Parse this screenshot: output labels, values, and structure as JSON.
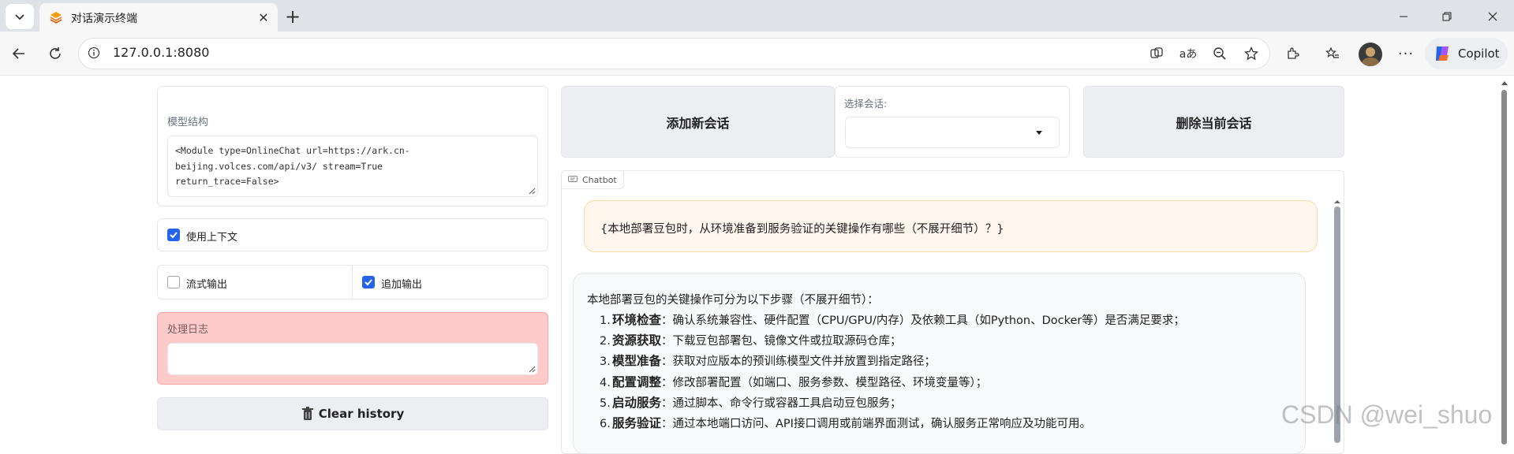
{
  "browser": {
    "tab_title": "对话演示终端",
    "url": "127.0.0.1:8080",
    "copilot_label": "Copilot",
    "translate_label": "aあ"
  },
  "left_panel": {
    "model_structure_label": "模型结构",
    "model_structure_value": "<Module type=OnlineChat url=https://ark.cn-\nbeijing.volces.com/api/v3/ stream=True\nreturn_trace=False>",
    "use_context_label": "使用上下文",
    "use_context_checked": true,
    "stream_output_label": "流式输出",
    "stream_output_checked": false,
    "append_output_label": "追加输出",
    "append_output_checked": true,
    "log_label": "处理日志",
    "log_value": "",
    "clear_history_label": "Clear history"
  },
  "top_controls": {
    "add_session_label": "添加新会话",
    "select_session_label": "选择会话:",
    "select_session_value": "",
    "delete_session_label": "删除当前会话"
  },
  "chatbot": {
    "label": "Chatbot",
    "user_message": "{本地部署豆包时，从环境准备到服务验证的关键操作有哪些（不展开细节）？}",
    "bot_intro": "本地部署豆包的关键操作可分为以下步骤（不展开细节）：",
    "steps": [
      {
        "num": "1.",
        "title": "环境检查",
        "text": "：确认系统兼容性、硬件配置（CPU/GPU/内存）及依赖工具（如Python、Docker等）是否满足要求；"
      },
      {
        "num": "2.",
        "title": "资源获取",
        "text": "：下载豆包部署包、镜像文件或拉取源码仓库；"
      },
      {
        "num": "3.",
        "title": "模型准备",
        "text": "：获取对应版本的预训练模型文件并放置到指定路径；"
      },
      {
        "num": "4.",
        "title": "配置调整",
        "text": "：修改部署配置（如端口、服务参数、模型路径、环境变量等）；"
      },
      {
        "num": "5.",
        "title": "启动服务",
        "text": "：通过脚本、命令行或容器工具启动豆包服务；"
      },
      {
        "num": "6.",
        "title": "服务验证",
        "text": "：通过本地端口访问、API接口调用或前端界面测试，确认服务正常响应及功能可用。"
      }
    ]
  },
  "watermark": "CSDN @wei_shuo",
  "colors": {
    "accent_blue": "#2563eb",
    "log_bg": "#fecaca",
    "user_bubble_bg": "#fff7ed",
    "user_bubble_border": "#fcd9a8"
  }
}
